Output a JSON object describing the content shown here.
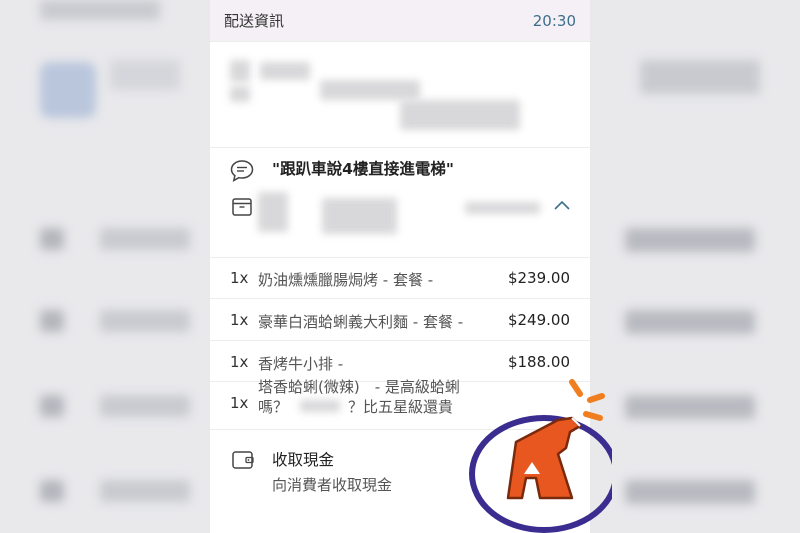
{
  "header": {
    "title": "配送資訊",
    "time": "20:30"
  },
  "note": {
    "text": "\"跟趴車說4樓直接進電梯\"",
    "icon": "chat-bubble-icon"
  },
  "customer": {
    "icon": "box-icon",
    "expand_icon": "chevron-up-icon"
  },
  "items": [
    {
      "qty": "1x",
      "name": "奶油燻燻臘腸焗烤 - 套餐 -",
      "price": "$239.00"
    },
    {
      "qty": "1x",
      "name": "豪華白酒蛤蜊義大利麵 - 套餐 -",
      "price": "$249.00"
    },
    {
      "qty": "1x",
      "name": "香烤牛小排 -",
      "price": "$188.00"
    },
    {
      "qty": "1x",
      "line1": "塔香蛤蜊(微辣)　- 是高級蛤蜊",
      "line2a": "嗎？",
      "line2b": "？比五星級還貴"
    }
  ],
  "payment": {
    "icon": "wallet-icon",
    "title": "收取現金",
    "subtitle": "向消費者收取現金"
  },
  "sticker": {
    "icon": "spray-bottle-sticker-icon",
    "colors": {
      "ring": "#3b2d8f",
      "bottle": "#e8571f",
      "burst": "#f07d1e"
    }
  }
}
